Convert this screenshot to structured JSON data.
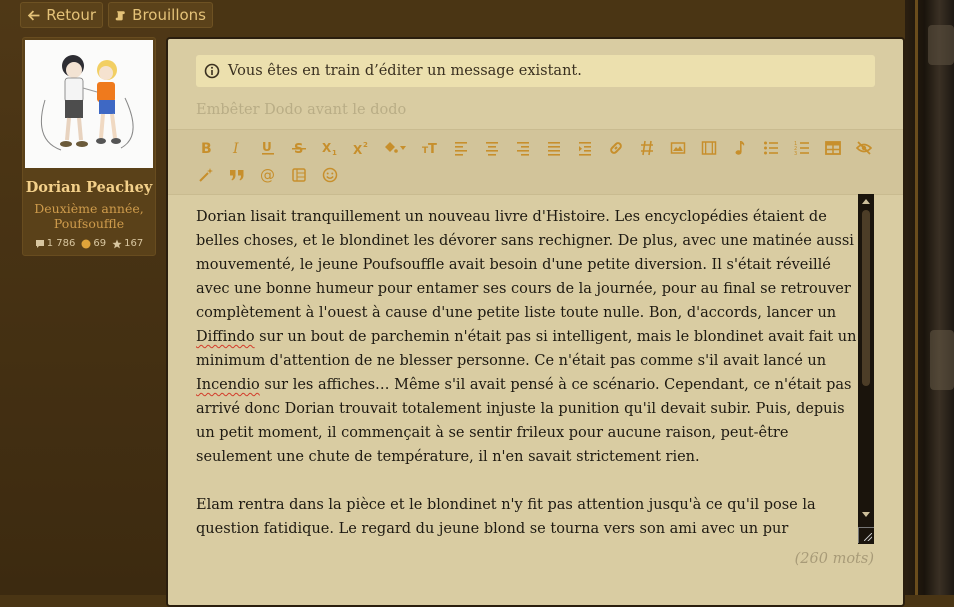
{
  "nav": {
    "back_label": "Retour",
    "drafts_label": "Brouillons"
  },
  "profile": {
    "name": "Dorian Peachey",
    "rank_line1": "Deuxième année,",
    "rank_line2": "Poufsouffle",
    "stats": {
      "messages": "1 786",
      "points": "69",
      "stars": "167"
    }
  },
  "editor": {
    "notice": "Vous êtes en train d’éditer un message existant.",
    "title_placeholder": "Embêter Dodo avant le dodo",
    "toolbar": {
      "row1": [
        "bold-icon",
        "italic-icon",
        "underline-icon",
        "strikethrough-icon",
        "subscript-icon",
        "superscript-icon",
        "fill-color-icon",
        "font-size-icon",
        "align-left-icon",
        "align-center-icon",
        "align-right-icon",
        "align-justify-icon",
        "indent-icon",
        "link-icon",
        "hashtag-icon",
        "image-icon",
        "video-icon",
        "music-icon",
        "bullet-list-icon",
        "numbered-list-icon",
        "table-icon",
        "hide-icon"
      ],
      "row2": [
        "magic-wand-icon",
        "quote-icon",
        "mention-icon",
        "spoiler-icon",
        "emoji-icon"
      ]
    },
    "paragraph1": {
      "before_diffindo": "Dorian lisait tranquillement un nouveau livre d'Histoire. Les encyclopédies étaient de belles choses, et le blondinet les dévorer sans rechigner. De plus, avec une matinée aussi mouvementé, le jeune Poufsouffle avait besoin d'une petite diversion. Il s'était réveillé avec une bonne humeur pour entamer ses cours de la journée, pour au final se retrouver complètement à l'ouest à cause d'une petite liste toute nulle. Bon, d'accords, lancer un ",
      "diffindo": "Diffindo",
      "middle": " sur un bout de parchemin n'était pas si intelligent, mais le blondinet avait fait un minimum d'attention de ne blesser personne. Ce n'était pas comme s'il avait lancé un ",
      "incendio": "Incendio",
      "after_incendio": " sur les affiches… Même s'il avait pensé à ce scénario. Cependant, ce n'était pas arrivé donc Dorian trouvait totalement injuste la punition qu'il devait subir. Puis, depuis un petit moment, il commençait à se sentir frileux pour aucune raison, peut-être seulement une chute de température, il n'en savait strictement rien."
    },
    "paragraph2": "Elam rentra dans la pièce et le blondinet n'y fit pas attention jusqu'à ce qu'il pose la question fatidique. Le regard du jeune blond se tourna vers son ami avec un pur agacement sur son",
    "word_count": "(260 mots)"
  },
  "colors": {
    "accent": "#c78f2c",
    "panel": "#d9cca2",
    "notice": "#ece0ae"
  }
}
